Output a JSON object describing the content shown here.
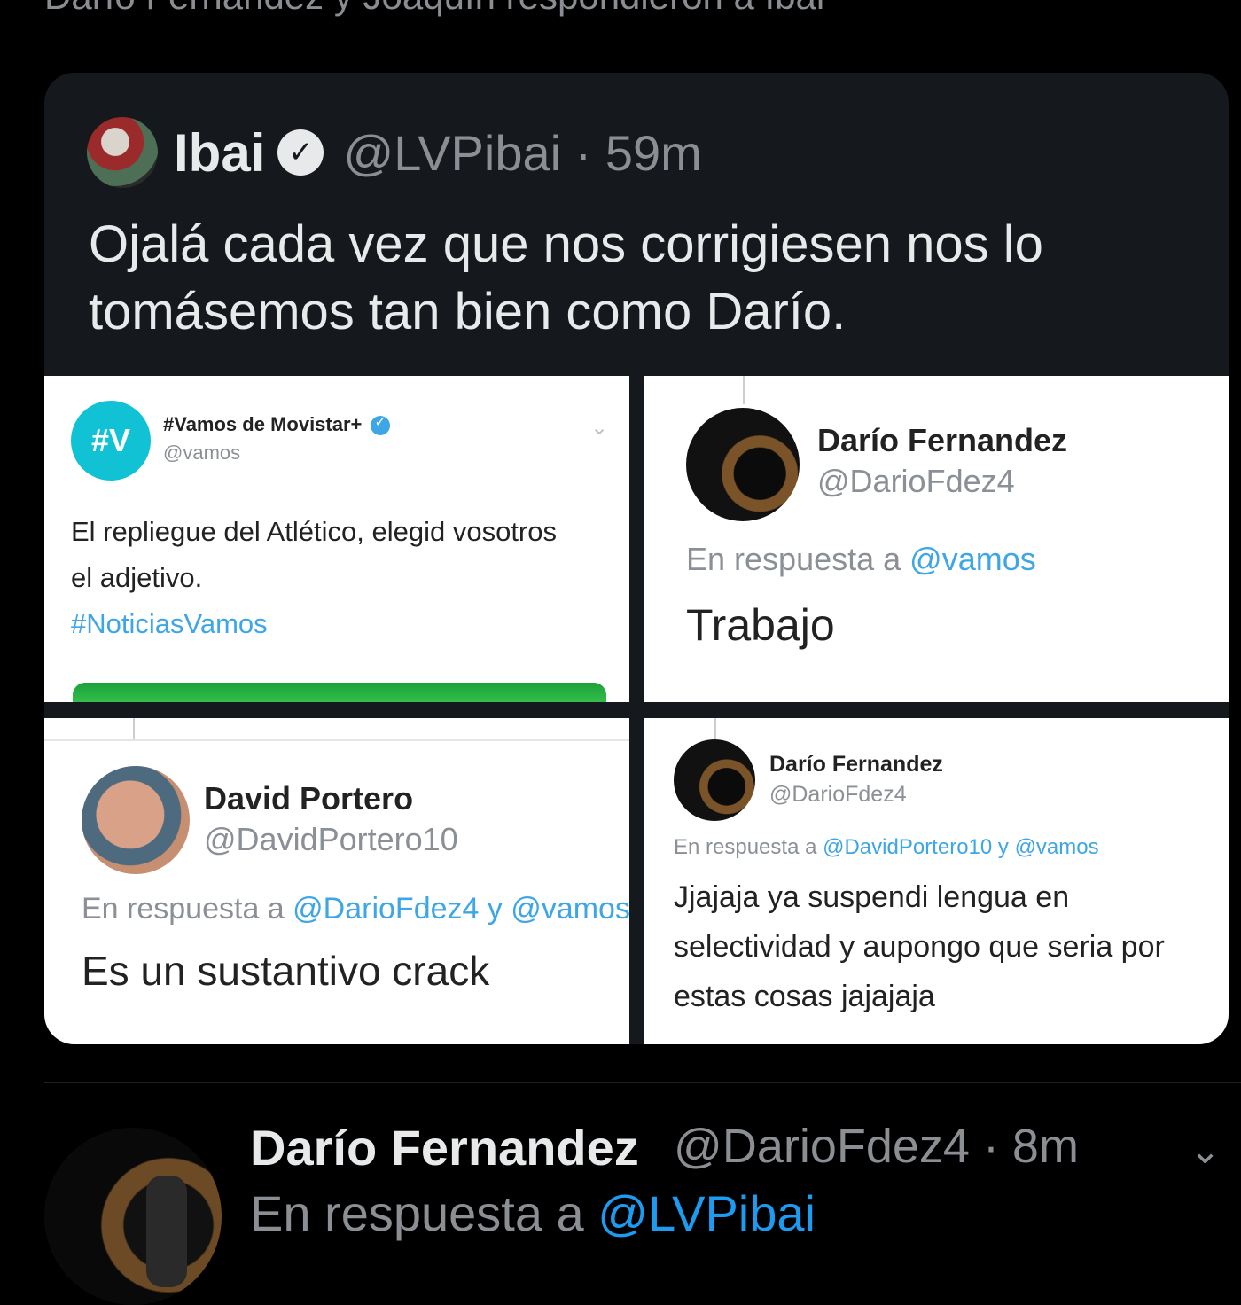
{
  "top_text": "Darío Fernandez y Joaquín respondieron a Ibai",
  "quote_tweet": {
    "name": "Ibai",
    "handle_time": "@LVPibai · 59m",
    "text": "Ojalá cada vez que nos corrigiesen nos lo tomásemos tan bien como Darío."
  },
  "cells": [
    {
      "name": "#Vamos de Movistar+",
      "handle": "@vamos",
      "text_line1": "El repliegue del Atlético, elegid vosotros",
      "text_line2": "el adjetivo.",
      "hashtag": "#NoticiasVamos",
      "avatar_label": "#V"
    },
    {
      "name": "Darío Fernandez",
      "handle": "@DarioFdez4",
      "reply_prefix": "En respuesta a ",
      "reply_mention": "@vamos",
      "text": "Trabajo"
    },
    {
      "name": "David Portero",
      "handle": "@DavidPortero10",
      "reply_prefix": "En respuesta a ",
      "reply_mention": "@DarioFdez4 y @vamos",
      "text": "Es un sustantivo crack"
    },
    {
      "name": "Darío Fernandez",
      "handle": "@DarioFdez4",
      "reply_prefix": "En respuesta a ",
      "reply_mention": "@DavidPortero10 y @vamos",
      "text": "Jjajaja ya suspendi lengua en selectividad y aupongo que seria por estas cosas jajajaja"
    }
  ],
  "bottom_tweet": {
    "name": "Darío Fernandez",
    "handle_time": "@DarioFdez4 · 8m",
    "reply_prefix": "En respuesta a ",
    "reply_mention": "@LVPibai"
  },
  "icons": {
    "verified": "check-badge-icon",
    "chevron": "chevron-down-icon"
  }
}
